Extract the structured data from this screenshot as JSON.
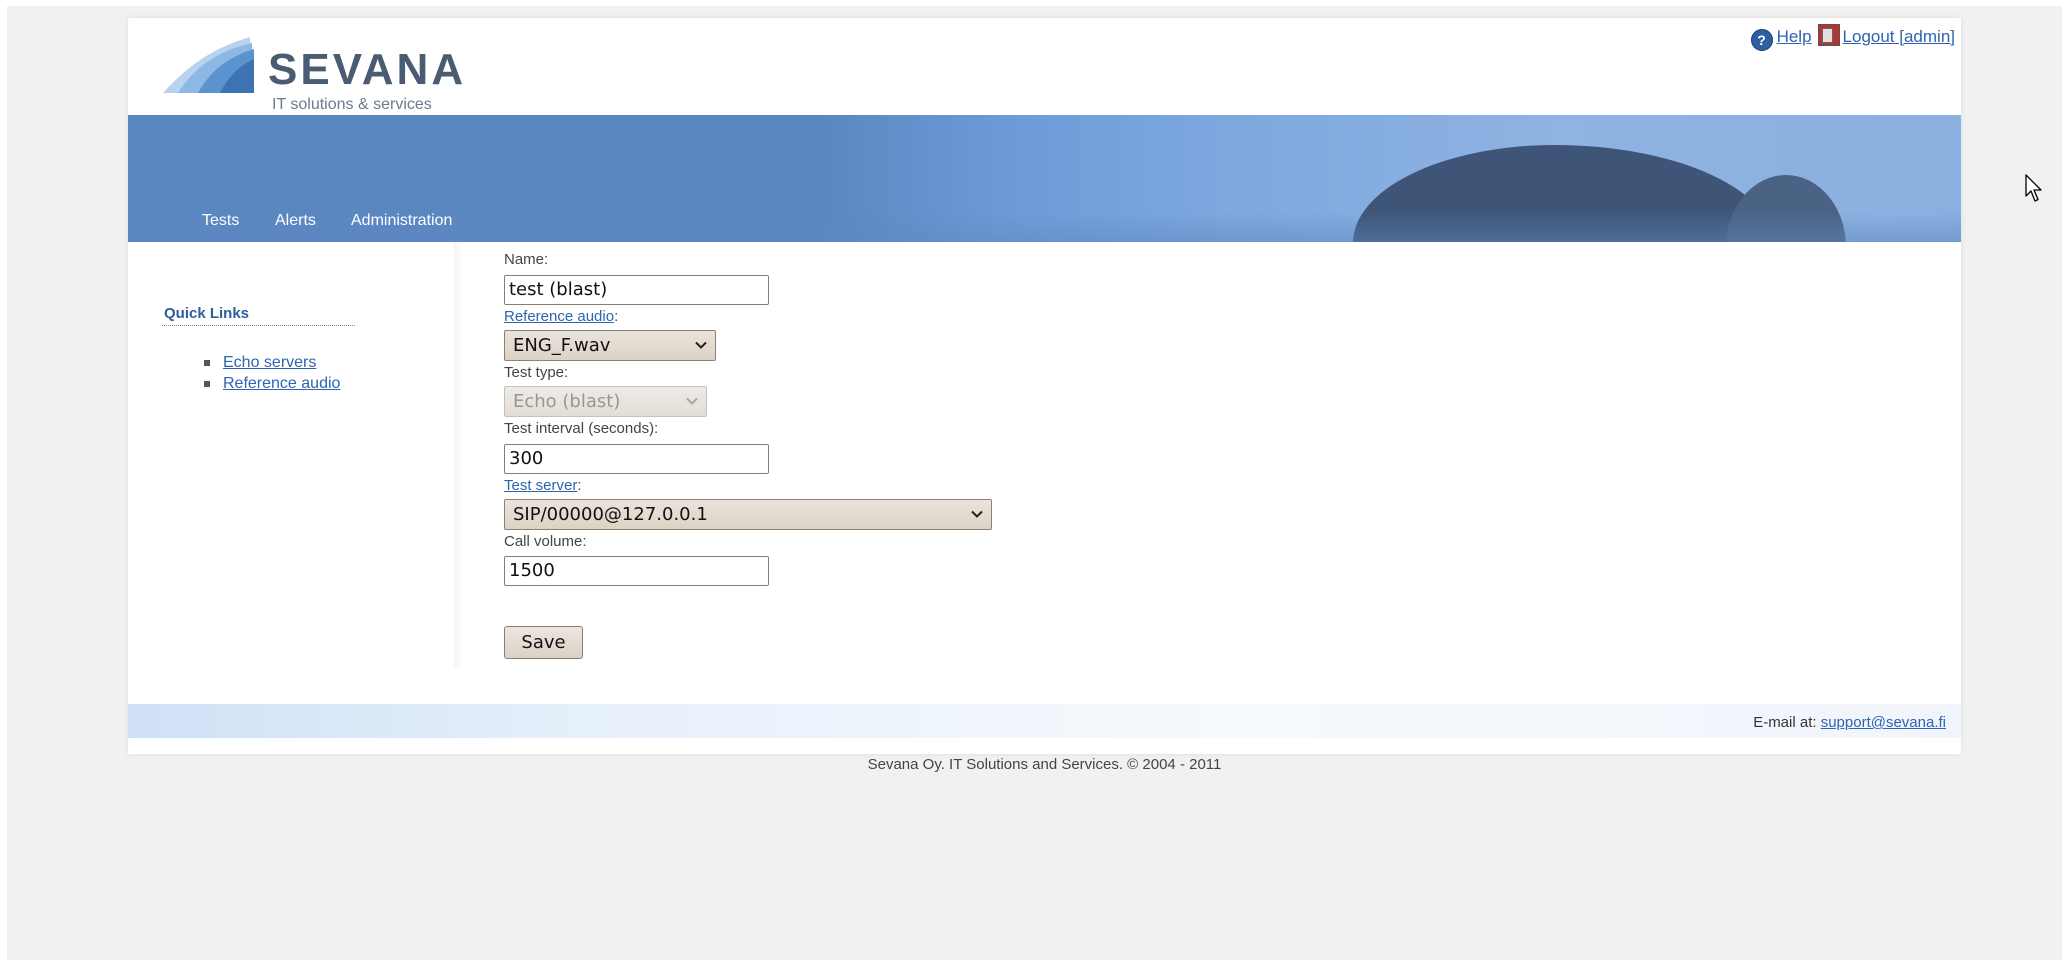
{
  "header": {
    "logo_wordmark": "SEVANA",
    "logo_tagline": "IT solutions & services",
    "help_label": "Help",
    "logout_label": "Logout [admin]"
  },
  "nav": {
    "items": [
      {
        "label": "Tests"
      },
      {
        "label": "Alerts"
      },
      {
        "label": "Administration"
      }
    ]
  },
  "sidebar": {
    "title": "Quick Links",
    "links": [
      {
        "label": "Echo servers"
      },
      {
        "label": "Reference audio"
      }
    ]
  },
  "form": {
    "name_label": "Name:",
    "name_value": "test (blast)",
    "reference_audio_link": "Reference audio",
    "colon": ":",
    "reference_audio_value": "ENG_F.wav",
    "test_type_label": "Test type:",
    "test_type_value": "Echo (blast)",
    "test_interval_label": "Test interval (seconds):",
    "test_interval_value": "300",
    "test_server_link": "Test server",
    "test_server_value": "SIP/00000@127.0.0.1",
    "call_volume_label": "Call volume:",
    "call_volume_value": "1500",
    "save_label": "Save"
  },
  "footer": {
    "email_prefix": "E-mail at: ",
    "email_address": "support@sevana.fi",
    "copyright": "Sevana Oy. IT Solutions and Services. © 2004 - 2011"
  },
  "colors": {
    "link": "#2e64b0",
    "banner": "#5b87c1",
    "quick_links_title": "#2e5f9c",
    "logo": "#4a5c72"
  }
}
